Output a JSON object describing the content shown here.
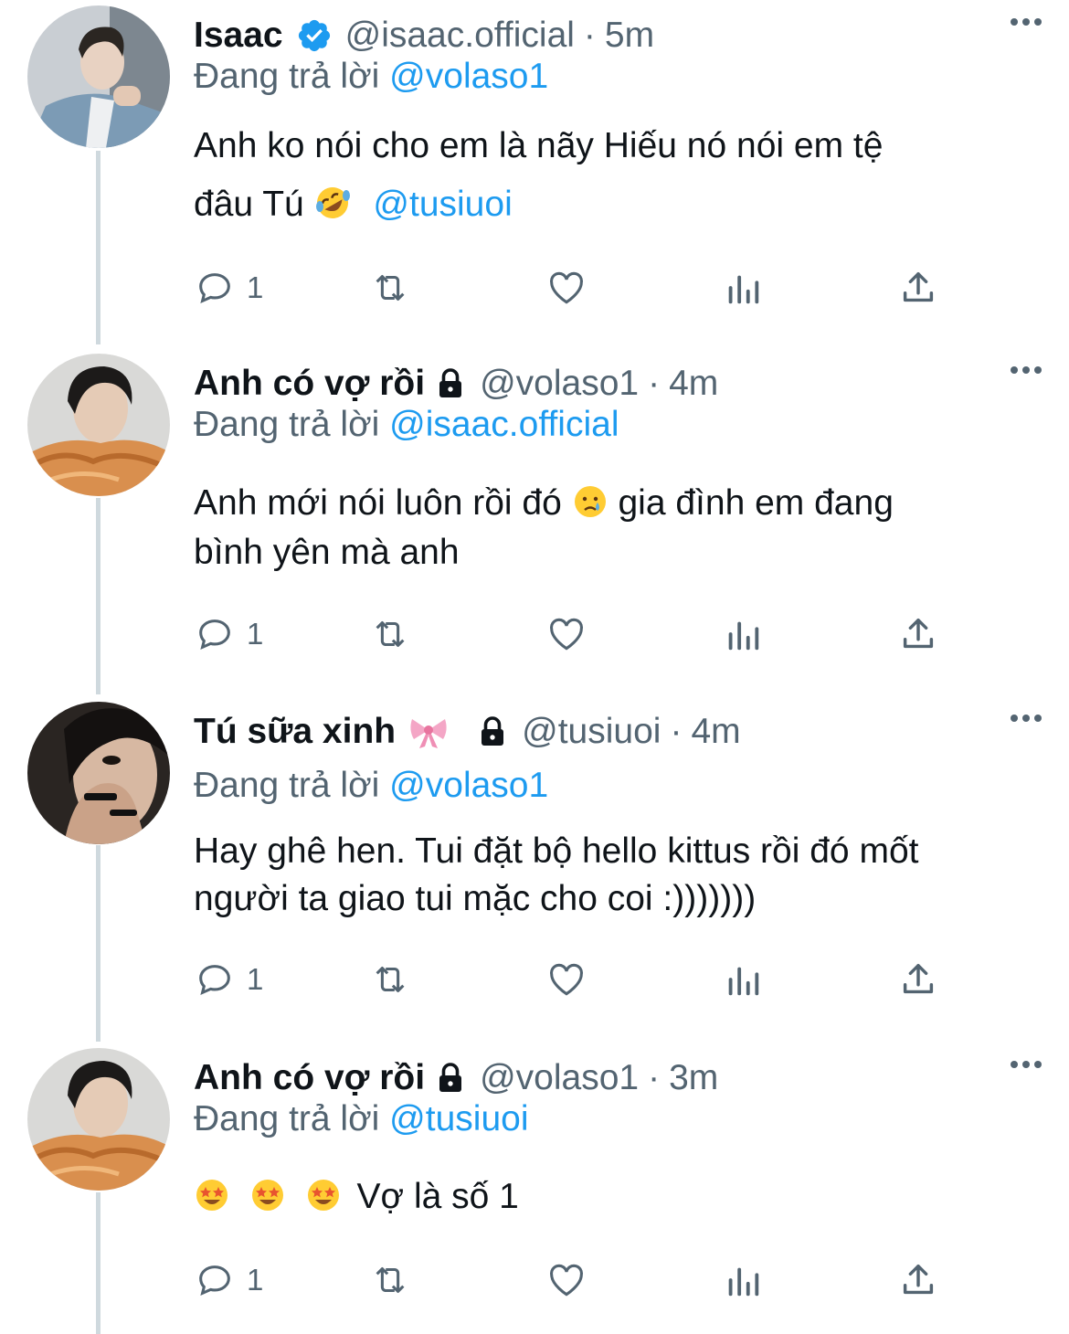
{
  "colors": {
    "accent": "#1d9bf0",
    "muted": "#536471",
    "text": "#0f1419",
    "thread": "#cfd9de"
  },
  "tweets": [
    {
      "name": "Isaac",
      "verified": true,
      "locked": false,
      "handle": "@isaac.official",
      "dot": "·",
      "time": "5m",
      "reply_prefix": "Đang trả lời",
      "reply_to": "@volaso1",
      "text_line1": "Anh ko nói cho em là nãy Hiếu nó nói em tệ",
      "text_line2": "đâu Tú",
      "emoji": "rofl-emoji",
      "mention": "@tusiuoi",
      "reply_count": "1",
      "avatar": "man-in-blue-suit-avatar"
    },
    {
      "name": "Anh có vợ rồi",
      "verified": false,
      "locked": true,
      "handle": "@volaso1",
      "dot": "·",
      "time": "4m",
      "reply_prefix": "Đang trả lời",
      "reply_to": "@isaac.official",
      "text_line1a": "Anh mới nói luôn rồi đó",
      "emoji": "crying-face-emoji",
      "text_line1b": "gia đình em đang",
      "text_line2": "bình yên mà anh",
      "reply_count": "1",
      "avatar": "man-with-pastry-avatar"
    },
    {
      "name": "Tú sữa xinh",
      "name_emoji": "ribbon-emoji",
      "verified": false,
      "locked": true,
      "handle": "@tusiuoi",
      "dot": "·",
      "time": "4m",
      "reply_prefix": "Đang trả lời",
      "reply_to": "@volaso1",
      "text_line1": "Hay ghê hen. Tui đặt bộ hello kittus rồi đó mốt",
      "text_line2": "người ta giao tui mặc cho coi :)))))))",
      "reply_count": "1",
      "avatar": "man-covering-face-avatar"
    },
    {
      "name": "Anh có vợ rồi",
      "verified": false,
      "locked": true,
      "handle": "@volaso1",
      "dot": "·",
      "time": "3m",
      "reply_prefix": "Đang trả lời",
      "reply_to": "@tusiuoi",
      "emojis": [
        "star-struck-emoji",
        "star-struck-emoji",
        "star-struck-emoji"
      ],
      "text_line1": "Vợ là số 1",
      "reply_count": "1",
      "avatar": "man-with-pastry-avatar"
    }
  ]
}
